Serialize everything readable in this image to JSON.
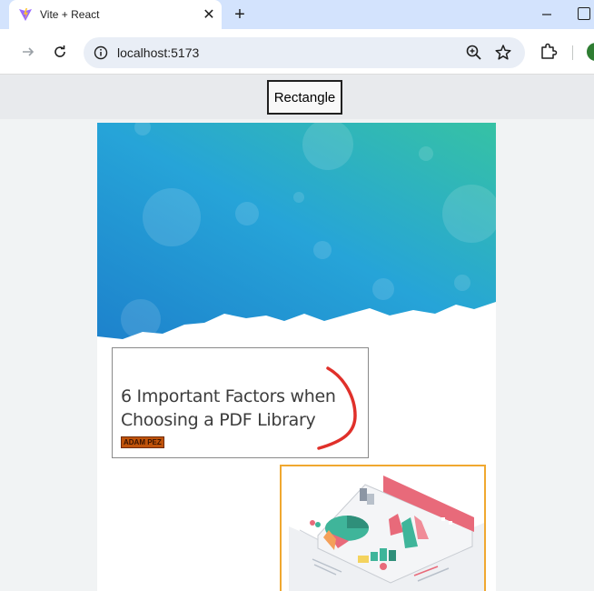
{
  "browser": {
    "tab_title": "Vite + React",
    "new_tab_symbol": "+",
    "close_symbol": "✕",
    "url": "localhost:5173"
  },
  "page": {
    "rectangle_button_label": "Rectangle",
    "pdf_card": {
      "title": "6 Important Factors when Choosing a PDF Library",
      "author": "ADAM PEZ"
    }
  },
  "icons": {
    "favicon": "vite-icon",
    "back": "arrow-right-icon",
    "reload": "reload-icon",
    "site_info": "info-icon",
    "zoom": "zoom-icon",
    "bookmark": "star-icon",
    "extensions": "puzzle-icon"
  },
  "colors": {
    "tab_strip": "#d3e3fd",
    "omnibox": "#e9eef6",
    "hero_top": "#2fbfae",
    "hero_bottom": "#1f8fd6",
    "author_tag": "#c0530a",
    "image_frame_border": "#f0a830"
  }
}
